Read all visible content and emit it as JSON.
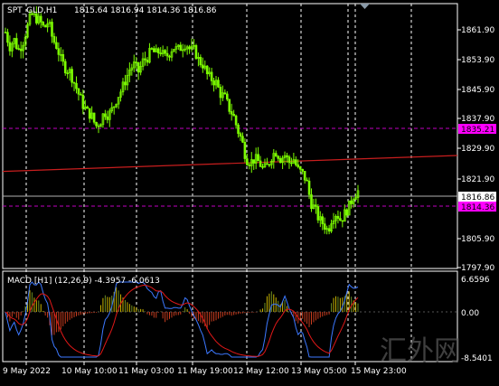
{
  "header": {
    "symbol": "SPT_GLD,H1",
    "ohlc": "1815.64 1816.94 1814.36 1816.86"
  },
  "price_axis": {
    "ticks": [
      "1861.90",
      "1853.90",
      "1845.90",
      "1837.90",
      "1829.90",
      "1821.90",
      "1805.90",
      "1797.90"
    ],
    "tick_values": [
      1861.9,
      1853.9,
      1845.9,
      1837.9,
      1829.9,
      1821.9,
      1805.9,
      1797.9
    ],
    "current_price": "1816.86",
    "upper_level": "1835.21",
    "lower_level": "1814.36"
  },
  "macd": {
    "title": "MACD [H1] (12,26,9) -4.3957 -6.0613",
    "ticks": [
      "6.6596",
      "0.00",
      "-8.5401"
    ]
  },
  "time_axis": {
    "labels": [
      "9 May 2022",
      "10 May 10:00",
      "11 May 03:00",
      "11 May 19:00",
      "12 May 12:00",
      "13 May 05:00",
      "15 May 23:00"
    ]
  },
  "watermark": "汇外网",
  "colors": {
    "background": "#000000",
    "candles": "#7CFC00",
    "grid": "#FFFFFF",
    "level_line": "#C000C0",
    "level_label_bg": "#FF00FF",
    "moving_average": "#C81E1E",
    "macd_line": "#3C78FF",
    "signal_line": "#E01818",
    "hist_up": "#C8B400",
    "hist_down": "#C83C1E",
    "hist_neutral": "#6B8E23"
  },
  "chart_data": {
    "type": "candlestick",
    "symbol": "SPT_GLD",
    "timeframe": "H1",
    "last_close": 1816.86,
    "ylim": [
      1795.9,
      1867.9
    ],
    "close_path": [
      1861,
      1857,
      1859,
      1856,
      1858,
      1862,
      1866,
      1865,
      1864,
      1862,
      1864,
      1859,
      1857,
      1853,
      1851,
      1850,
      1847,
      1844,
      1841,
      1839,
      1838,
      1835,
      1836,
      1839,
      1838,
      1840,
      1843,
      1845,
      1848,
      1851,
      1852,
      1850,
      1853,
      1854,
      1856,
      1855,
      1856,
      1854,
      1855,
      1857,
      1856,
      1857,
      1858,
      1856,
      1856,
      1853,
      1852,
      1849,
      1848,
      1847,
      1844,
      1843,
      1840,
      1838,
      1834,
      1831,
      1826,
      1825,
      1826,
      1825,
      1823,
      1824,
      1827,
      1828,
      1826,
      1827,
      1825,
      1826,
      1823,
      1822,
      1820,
      1814,
      1812,
      1809,
      1808,
      1806,
      1810,
      1811,
      1809,
      1811,
      1813,
      1816,
      1817
    ],
    "moving_average": [
      1822.5,
      1826.9
    ],
    "macd_main_range": [
      -8.54,
      6.66
    ]
  }
}
